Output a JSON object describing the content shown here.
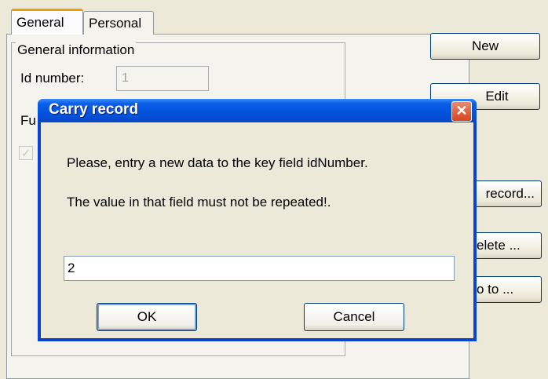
{
  "tabs": [
    {
      "label": "General"
    },
    {
      "label": "Personal"
    }
  ],
  "form": {
    "group_title": "General information",
    "id_label": "Id number:",
    "id_value": "1",
    "fu_label_fragment": "Fu",
    "check_glyph": "✓"
  },
  "side_buttons": {
    "new": "New",
    "edit": "Edit",
    "record": "record...",
    "delete": "elete ...",
    "goto": "o to ..."
  },
  "dialog": {
    "title": "Carry record",
    "close_glyph": "✕",
    "message_1": "Please, entry a new data to the key field idNumber.",
    "message_2": "The value in that field must not be repeated!.",
    "input_value": "2",
    "ok_label": "OK",
    "cancel_label": "Cancel"
  }
}
